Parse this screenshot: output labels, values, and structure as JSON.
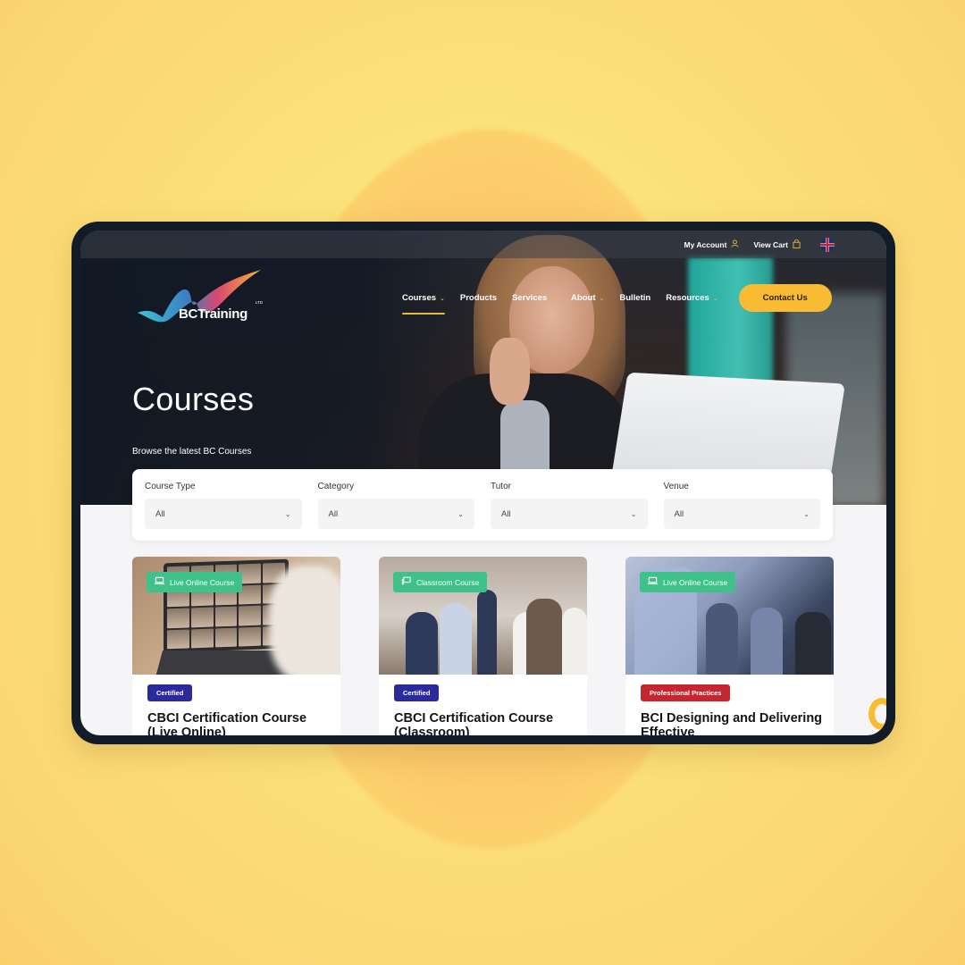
{
  "topbar": {
    "my_account": "My Account",
    "account_icon": "user-icon",
    "view_cart": "View Cart",
    "cart_icon": "shopping-bag-icon",
    "language_icon": "uk-flag-icon"
  },
  "brand": {
    "name": "BCTraining",
    "suffix": "LTD"
  },
  "nav": {
    "items": [
      {
        "label": "Courses",
        "dropdown": true,
        "active": true
      },
      {
        "label": "Products",
        "dropdown": false,
        "active": false
      },
      {
        "label": "Services",
        "dropdown": true,
        "active": false
      },
      {
        "label": "About",
        "dropdown": true,
        "active": false
      },
      {
        "label": "Bulletin",
        "dropdown": false,
        "active": false
      },
      {
        "label": "Resources",
        "dropdown": true,
        "active": false
      }
    ],
    "cta_label": "Contact Us"
  },
  "hero": {
    "title": "Courses",
    "subtitle": "Browse the latest BC Courses"
  },
  "filters": [
    {
      "label": "Course Type",
      "value": "All"
    },
    {
      "label": "Category",
      "value": "All"
    },
    {
      "label": "Tutor",
      "value": "All"
    },
    {
      "label": "Venue",
      "value": "All"
    }
  ],
  "courses": [
    {
      "format": "Live Online Course",
      "format_icon": "laptop-icon",
      "badge": "Certified",
      "badge_color": "#2b2a9c",
      "title": "CBCI Certification Course (Live Online)"
    },
    {
      "format": "Classroom Course",
      "format_icon": "presentation-icon",
      "badge": "Certified",
      "badge_color": "#2b2a9c",
      "title": "CBCI Certification Course (Classroom)"
    },
    {
      "format": "Live Online Course",
      "format_icon": "laptop-icon",
      "badge": "Professional Practices",
      "badge_color": "#c6262f",
      "title": "BCI Designing and Delivering Effective"
    }
  ],
  "colors": {
    "accent_yellow": "#f8bb33",
    "tag_green": "#3fc28a",
    "dark_navy": "#121b28"
  }
}
